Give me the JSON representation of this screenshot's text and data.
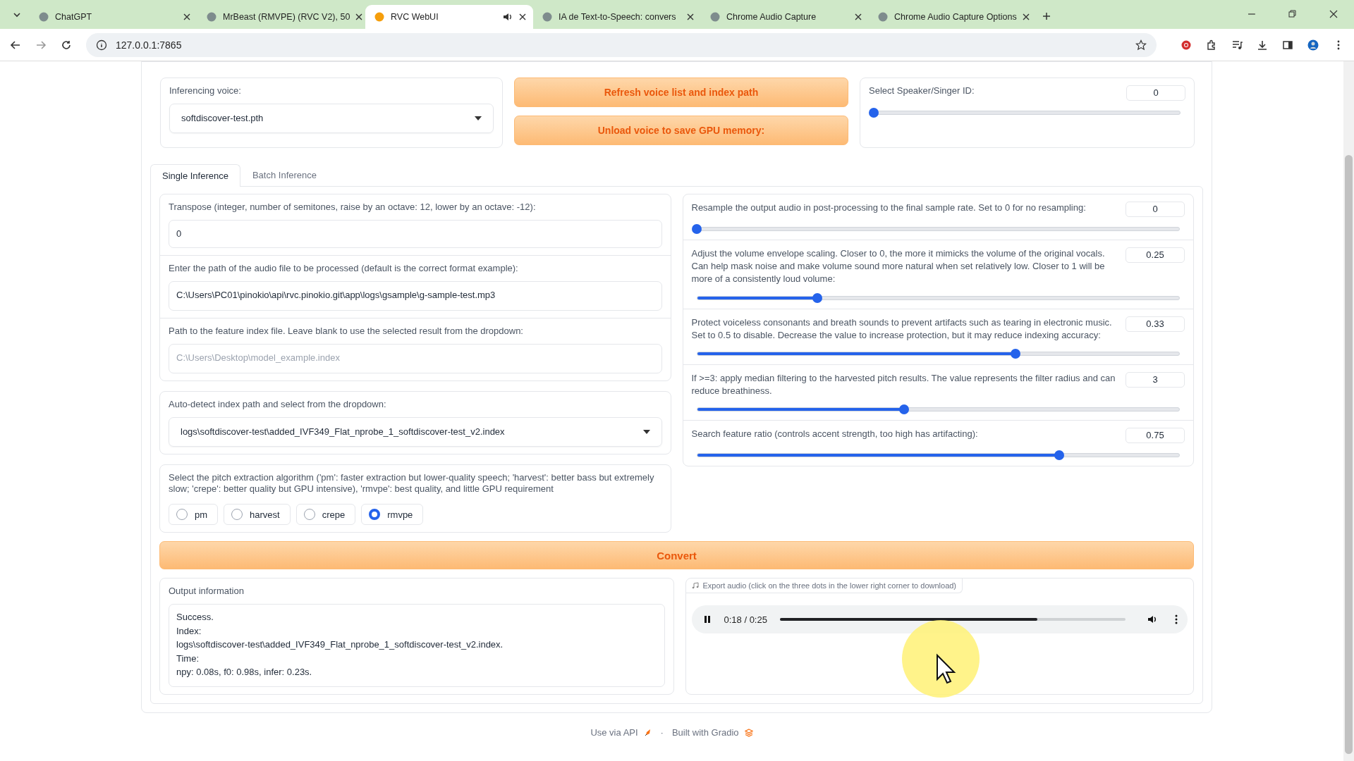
{
  "browser": {
    "tabs": [
      {
        "title": "ChatGPT",
        "selected": false,
        "audio": false
      },
      {
        "title": "MrBeast (RMVPE) (RVC V2), 50",
        "selected": false,
        "audio": false
      },
      {
        "title": "RVC WebUI",
        "selected": true,
        "audio": true
      },
      {
        "title": "IA de Text-to-Speech: convers",
        "selected": false,
        "audio": false
      },
      {
        "title": "Chrome Audio Capture",
        "selected": false,
        "audio": false
      },
      {
        "title": "Chrome Audio Capture Options",
        "selected": false,
        "audio": false
      }
    ],
    "url": "127.0.0.1:7865"
  },
  "voice": {
    "label": "Inferencing voice:",
    "value": "softdiscover-test.pth"
  },
  "buttons": [
    "Refresh voice list and index path",
    "Unload voice to save GPU memory:"
  ],
  "speaker": {
    "label": "Select Speaker/Singer ID:",
    "value": "0",
    "level": 0
  },
  "inference_tabs": [
    {
      "label": "Single Inference",
      "selected": true
    },
    {
      "label": "Batch Inference",
      "selected": false
    }
  ],
  "transpose": {
    "label": "Transpose (integer, number of semitones, raise by an octave: 12, lower by an octave: -12):",
    "value": "0"
  },
  "audio_path": {
    "label": "Enter the path of the audio file to be processed (default is the correct format example):",
    "value": "C:\\Users\\PC01\\pinokio\\api\\rvc.pinokio.git\\app\\logs\\gsample\\g-sample-test.mp3"
  },
  "index_path": {
    "label": "Path to the feature index file. Leave blank to use the selected result from the dropdown:",
    "placeholder": "C:\\Users\\Desktop\\model_example.index"
  },
  "index_dropdown": {
    "label": "Auto-detect index path and select from the dropdown:",
    "value": "logs\\softdiscover-test\\added_IVF349_Flat_nprobe_1_softdiscover-test_v2.index"
  },
  "pitch": {
    "label": "Select the pitch extraction algorithm ('pm': faster extraction but lower-quality speech; 'harvest': better bass but extremely slow; 'crepe': better quality but GPU intensive), 'rmvpe': best quality, and little GPU requirement",
    "options": [
      {
        "label": "pm",
        "selected": false
      },
      {
        "label": "harvest",
        "selected": false
      },
      {
        "label": "crepe",
        "selected": false
      },
      {
        "label": "rmvpe",
        "selected": true
      }
    ]
  },
  "sliders": [
    {
      "label": "Resample the output audio in post-processing to the final sample rate. Set to 0 for no resampling:",
      "value": "0",
      "level": 0
    },
    {
      "label": "Adjust the volume envelope scaling. Closer to 0, the more it mimicks the volume of the original vocals. Can help mask noise and make volume sound more natural when set relatively low. Closer to 1 will be more of a consistently loud volume:",
      "value": "0.25",
      "level": 0.25
    },
    {
      "label": "Protect voiceless consonants and breath sounds to prevent artifacts such as tearing in electronic music. Set to 0.5 to disable. Decrease the value to increase protection, but it may reduce indexing accuracy:",
      "value": "0.33",
      "level": 0.66
    },
    {
      "label": "If >=3: apply median filtering to the harvested pitch results. The value represents the filter radius and can reduce breathiness.",
      "value": "3",
      "level": 0.43
    },
    {
      "label": "Search feature ratio (controls accent strength, too high has artifacting):",
      "value": "0.75",
      "level": 0.75
    }
  ],
  "convert": "Convert",
  "output": {
    "label": "Output information",
    "value": "Success.\nIndex:\nlogs\\softdiscover-test\\added_IVF349_Flat_nprobe_1_softdiscover-test_v2.index.\nTime:\nnpy: 0.08s, f0: 0.98s, infer: 0.23s."
  },
  "audio": {
    "label": "Export audio (click on the three dots in the lower right corner to download)",
    "time": "0:18 / 0:25",
    "playing": true,
    "level": 0.745
  },
  "footer": {
    "api": "Use via API",
    "separator": "·",
    "built": "Built with Gradio"
  }
}
